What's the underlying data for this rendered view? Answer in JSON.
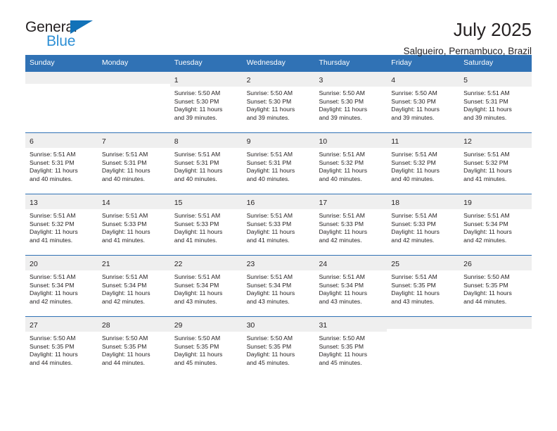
{
  "brand": {
    "name_top": "General",
    "name_bottom": "Blue",
    "triangle_color": "#1272b8",
    "blue_text_color": "#2d8fd5"
  },
  "header": {
    "title": "July 2025",
    "location": "Salgueiro, Pernambuco, Brazil"
  },
  "theme": {
    "header_blue": "#3072b5",
    "day_band_gray": "#efefef",
    "text_color": "#231f20"
  },
  "weekdays": [
    "Sunday",
    "Monday",
    "Tuesday",
    "Wednesday",
    "Thursday",
    "Friday",
    "Saturday"
  ],
  "weeks": [
    [
      {
        "day": "",
        "empty": true,
        "lines": []
      },
      {
        "day": "",
        "empty": true,
        "lines": []
      },
      {
        "day": "1",
        "empty": false,
        "lines": [
          "Sunrise: 5:50 AM",
          "Sunset: 5:30 PM",
          "Daylight: 11 hours",
          "and 39 minutes."
        ]
      },
      {
        "day": "2",
        "empty": false,
        "lines": [
          "Sunrise: 5:50 AM",
          "Sunset: 5:30 PM",
          "Daylight: 11 hours",
          "and 39 minutes."
        ]
      },
      {
        "day": "3",
        "empty": false,
        "lines": [
          "Sunrise: 5:50 AM",
          "Sunset: 5:30 PM",
          "Daylight: 11 hours",
          "and 39 minutes."
        ]
      },
      {
        "day": "4",
        "empty": false,
        "lines": [
          "Sunrise: 5:50 AM",
          "Sunset: 5:30 PM",
          "Daylight: 11 hours",
          "and 39 minutes."
        ]
      },
      {
        "day": "5",
        "empty": false,
        "lines": [
          "Sunrise: 5:51 AM",
          "Sunset: 5:31 PM",
          "Daylight: 11 hours",
          "and 39 minutes."
        ]
      }
    ],
    [
      {
        "day": "6",
        "empty": false,
        "lines": [
          "Sunrise: 5:51 AM",
          "Sunset: 5:31 PM",
          "Daylight: 11 hours",
          "and 40 minutes."
        ]
      },
      {
        "day": "7",
        "empty": false,
        "lines": [
          "Sunrise: 5:51 AM",
          "Sunset: 5:31 PM",
          "Daylight: 11 hours",
          "and 40 minutes."
        ]
      },
      {
        "day": "8",
        "empty": false,
        "lines": [
          "Sunrise: 5:51 AM",
          "Sunset: 5:31 PM",
          "Daylight: 11 hours",
          "and 40 minutes."
        ]
      },
      {
        "day": "9",
        "empty": false,
        "lines": [
          "Sunrise: 5:51 AM",
          "Sunset: 5:31 PM",
          "Daylight: 11 hours",
          "and 40 minutes."
        ]
      },
      {
        "day": "10",
        "empty": false,
        "lines": [
          "Sunrise: 5:51 AM",
          "Sunset: 5:32 PM",
          "Daylight: 11 hours",
          "and 40 minutes."
        ]
      },
      {
        "day": "11",
        "empty": false,
        "lines": [
          "Sunrise: 5:51 AM",
          "Sunset: 5:32 PM",
          "Daylight: 11 hours",
          "and 40 minutes."
        ]
      },
      {
        "day": "12",
        "empty": false,
        "lines": [
          "Sunrise: 5:51 AM",
          "Sunset: 5:32 PM",
          "Daylight: 11 hours",
          "and 41 minutes."
        ]
      }
    ],
    [
      {
        "day": "13",
        "empty": false,
        "lines": [
          "Sunrise: 5:51 AM",
          "Sunset: 5:32 PM",
          "Daylight: 11 hours",
          "and 41 minutes."
        ]
      },
      {
        "day": "14",
        "empty": false,
        "lines": [
          "Sunrise: 5:51 AM",
          "Sunset: 5:33 PM",
          "Daylight: 11 hours",
          "and 41 minutes."
        ]
      },
      {
        "day": "15",
        "empty": false,
        "lines": [
          "Sunrise: 5:51 AM",
          "Sunset: 5:33 PM",
          "Daylight: 11 hours",
          "and 41 minutes."
        ]
      },
      {
        "day": "16",
        "empty": false,
        "lines": [
          "Sunrise: 5:51 AM",
          "Sunset: 5:33 PM",
          "Daylight: 11 hours",
          "and 41 minutes."
        ]
      },
      {
        "day": "17",
        "empty": false,
        "lines": [
          "Sunrise: 5:51 AM",
          "Sunset: 5:33 PM",
          "Daylight: 11 hours",
          "and 42 minutes."
        ]
      },
      {
        "day": "18",
        "empty": false,
        "lines": [
          "Sunrise: 5:51 AM",
          "Sunset: 5:33 PM",
          "Daylight: 11 hours",
          "and 42 minutes."
        ]
      },
      {
        "day": "19",
        "empty": false,
        "lines": [
          "Sunrise: 5:51 AM",
          "Sunset: 5:34 PM",
          "Daylight: 11 hours",
          "and 42 minutes."
        ]
      }
    ],
    [
      {
        "day": "20",
        "empty": false,
        "lines": [
          "Sunrise: 5:51 AM",
          "Sunset: 5:34 PM",
          "Daylight: 11 hours",
          "and 42 minutes."
        ]
      },
      {
        "day": "21",
        "empty": false,
        "lines": [
          "Sunrise: 5:51 AM",
          "Sunset: 5:34 PM",
          "Daylight: 11 hours",
          "and 42 minutes."
        ]
      },
      {
        "day": "22",
        "empty": false,
        "lines": [
          "Sunrise: 5:51 AM",
          "Sunset: 5:34 PM",
          "Daylight: 11 hours",
          "and 43 minutes."
        ]
      },
      {
        "day": "23",
        "empty": false,
        "lines": [
          "Sunrise: 5:51 AM",
          "Sunset: 5:34 PM",
          "Daylight: 11 hours",
          "and 43 minutes."
        ]
      },
      {
        "day": "24",
        "empty": false,
        "lines": [
          "Sunrise: 5:51 AM",
          "Sunset: 5:34 PM",
          "Daylight: 11 hours",
          "and 43 minutes."
        ]
      },
      {
        "day": "25",
        "empty": false,
        "lines": [
          "Sunrise: 5:51 AM",
          "Sunset: 5:35 PM",
          "Daylight: 11 hours",
          "and 43 minutes."
        ]
      },
      {
        "day": "26",
        "empty": false,
        "lines": [
          "Sunrise: 5:50 AM",
          "Sunset: 5:35 PM",
          "Daylight: 11 hours",
          "and 44 minutes."
        ]
      }
    ],
    [
      {
        "day": "27",
        "empty": false,
        "lines": [
          "Sunrise: 5:50 AM",
          "Sunset: 5:35 PM",
          "Daylight: 11 hours",
          "and 44 minutes."
        ]
      },
      {
        "day": "28",
        "empty": false,
        "lines": [
          "Sunrise: 5:50 AM",
          "Sunset: 5:35 PM",
          "Daylight: 11 hours",
          "and 44 minutes."
        ]
      },
      {
        "day": "29",
        "empty": false,
        "lines": [
          "Sunrise: 5:50 AM",
          "Sunset: 5:35 PM",
          "Daylight: 11 hours",
          "and 45 minutes."
        ]
      },
      {
        "day": "30",
        "empty": false,
        "lines": [
          "Sunrise: 5:50 AM",
          "Sunset: 5:35 PM",
          "Daylight: 11 hours",
          "and 45 minutes."
        ]
      },
      {
        "day": "31",
        "empty": false,
        "lines": [
          "Sunrise: 5:50 AM",
          "Sunset: 5:35 PM",
          "Daylight: 11 hours",
          "and 45 minutes."
        ]
      },
      {
        "day": "",
        "empty": true,
        "lines": []
      },
      {
        "day": "",
        "empty": true,
        "lines": []
      }
    ]
  ]
}
